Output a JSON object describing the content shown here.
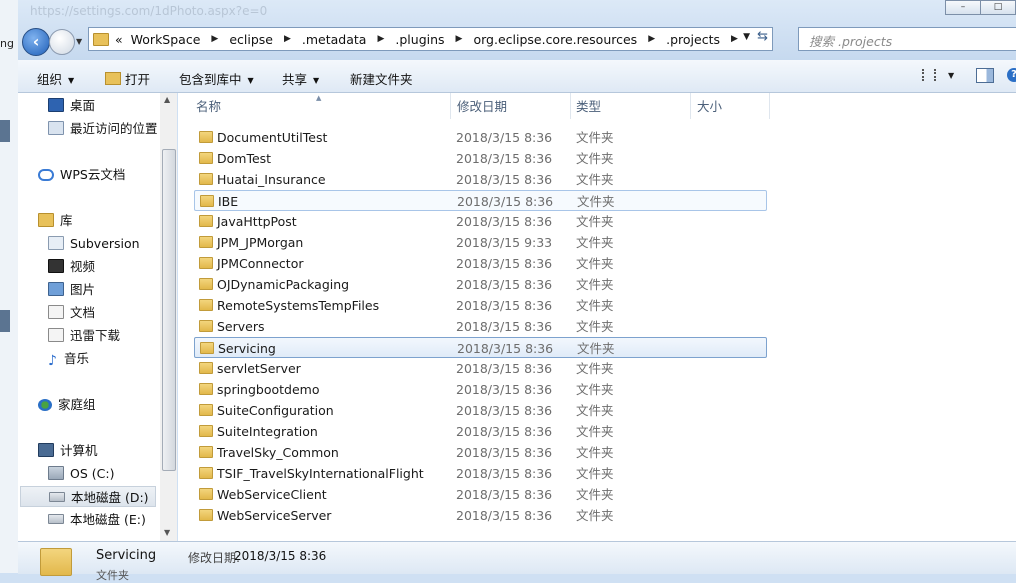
{
  "background": {
    "ghost_url": "https://settings.com/1dPhoto.aspx?e=0",
    "left_fragment": "ng"
  },
  "window_buttons": [
    "–",
    "□"
  ],
  "address": {
    "overflow": "«",
    "crumbs": [
      "WorkSpace",
      "eclipse",
      ".metadata",
      ".plugins",
      "org.eclipse.core.resources",
      ".projects"
    ]
  },
  "search": {
    "placeholder": "搜索 .projects"
  },
  "toolbar": {
    "organize": "组织",
    "open": "打开",
    "include_in_library": "包含到库中",
    "share": "共享",
    "new_folder": "新建文件夹"
  },
  "nav": {
    "desktop": "桌面",
    "recent": "最近访问的位置",
    "wps": "WPS云文档",
    "library": "库",
    "subversion": "Subversion",
    "video": "视频",
    "pictures": "图片",
    "documents": "文档",
    "thunder": "迅雷下载",
    "music": "音乐",
    "homegroup": "家庭组",
    "computer": "计算机",
    "os_c": "OS (C:)",
    "disk_d": "本地磁盘 (D:)",
    "disk_e": "本地磁盘 (E:)"
  },
  "columns": {
    "name": "名称",
    "date": "修改日期",
    "type": "类型",
    "size": "大小"
  },
  "files": [
    {
      "name": "DocumentUtilTest",
      "date": "2018/3/15 8:36",
      "type": "文件夹"
    },
    {
      "name": "DomTest",
      "date": "2018/3/15 8:36",
      "type": "文件夹"
    },
    {
      "name": "Huatai_Insurance",
      "date": "2018/3/15 8:36",
      "type": "文件夹"
    },
    {
      "name": "IBE",
      "date": "2018/3/15 8:36",
      "type": "文件夹"
    },
    {
      "name": "JavaHttpPost",
      "date": "2018/3/15 8:36",
      "type": "文件夹"
    },
    {
      "name": "JPM_JPMorgan",
      "date": "2018/3/15 9:33",
      "type": "文件夹"
    },
    {
      "name": "JPMConnector",
      "date": "2018/3/15 8:36",
      "type": "文件夹"
    },
    {
      "name": "OJDynamicPackaging",
      "date": "2018/3/15 8:36",
      "type": "文件夹"
    },
    {
      "name": "RemoteSystemsTempFiles",
      "date": "2018/3/15 8:36",
      "type": "文件夹"
    },
    {
      "name": "Servers",
      "date": "2018/3/15 8:36",
      "type": "文件夹"
    },
    {
      "name": "Servicing",
      "date": "2018/3/15 8:36",
      "type": "文件夹"
    },
    {
      "name": "servletServer",
      "date": "2018/3/15 8:36",
      "type": "文件夹"
    },
    {
      "name": "springbootdemo",
      "date": "2018/3/15 8:36",
      "type": "文件夹"
    },
    {
      "name": "SuiteConfiguration",
      "date": "2018/3/15 8:36",
      "type": "文件夹"
    },
    {
      "name": "SuiteIntegration",
      "date": "2018/3/15 8:36",
      "type": "文件夹"
    },
    {
      "name": "TravelSky_Common",
      "date": "2018/3/15 8:36",
      "type": "文件夹"
    },
    {
      "name": "TSIF_TravelSkyInternationalFlight",
      "date": "2018/3/15 8:36",
      "type": "文件夹"
    },
    {
      "name": "WebServiceClient",
      "date": "2018/3/15 8:36",
      "type": "文件夹"
    },
    {
      "name": "WebServiceServer",
      "date": "2018/3/15 8:36",
      "type": "文件夹"
    }
  ],
  "details": {
    "name": "Servicing",
    "modified_label": "修改日期:",
    "modified_value": "2018/3/15 8:36",
    "type": "文件夹"
  }
}
